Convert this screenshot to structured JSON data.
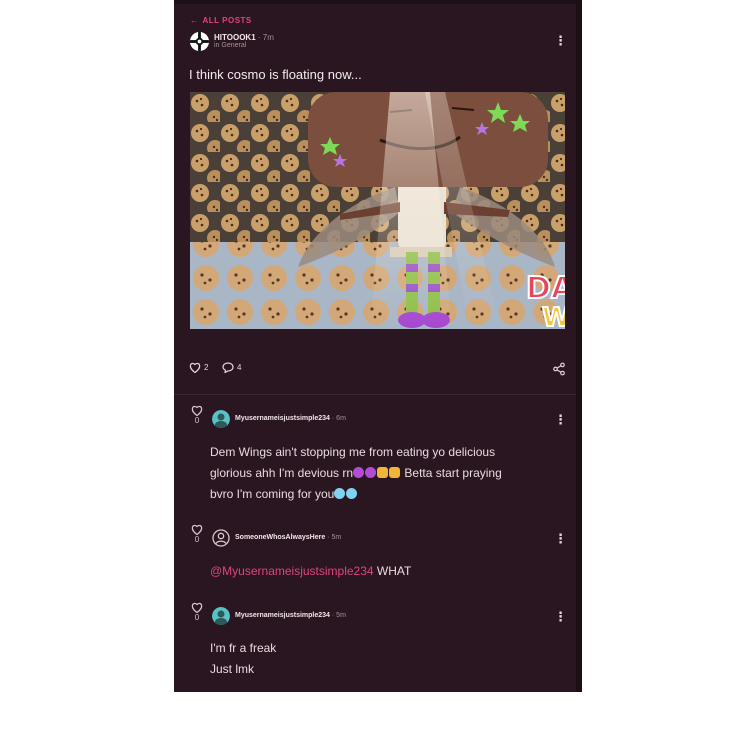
{
  "nav": {
    "back_label": "ALL POSTS"
  },
  "post": {
    "author": "HITOOOK1",
    "time": "7m",
    "community": "in General",
    "title": "I think cosmo is floating now...",
    "like_count": "2",
    "comment_count": "4",
    "image_caption_letters": "DA\nW"
  },
  "comments": [
    {
      "votes": "0",
      "author": "Myusernameisjustsimple234",
      "time": "6m",
      "lines": [
        "Dem Wings ain't stopping me from eating yo delicious",
        "glorious ahh I'm devious rn",
        "Betta start praying",
        "bvro I'm coming for you"
      ]
    },
    {
      "votes": "0",
      "author": "SomeoneWhosAlwaysHere",
      "time": "5m",
      "mention": "@Myusernameisjustsimple234",
      "text": " WHAT"
    },
    {
      "votes": "0",
      "author": "Myusernameisjustsimple234",
      "time": "5m",
      "lines": [
        "I'm fr a freak",
        "Just lmk"
      ]
    }
  ],
  "colors": {
    "panel": "#2a1620",
    "accent": "#e0447c",
    "text": "#f2e6ea"
  },
  "icons": [
    "back-arrow-icon",
    "kebab-menu-icon",
    "heart-icon",
    "comment-bubble-icon",
    "share-icon",
    "user-outline-icon"
  ]
}
